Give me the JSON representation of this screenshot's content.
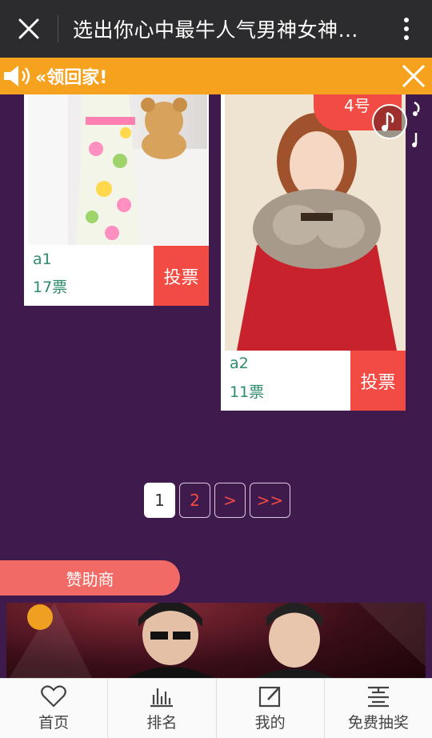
{
  "topbar": {
    "title": "选出你心中最牛人气男神女神…"
  },
  "banner": {
    "text": "«领回家!"
  },
  "contestants": [
    {
      "name": "a1",
      "votes": "17票",
      "vote_label": "投票"
    },
    {
      "name": "a2",
      "votes": "11票",
      "vote_label": "投票",
      "number_badge": "4号"
    }
  ],
  "pagination": {
    "pages": [
      "1",
      "2",
      ">",
      ">>"
    ],
    "current": "1"
  },
  "sponsor": {
    "label": "赞助商"
  },
  "bottom_nav": [
    {
      "label": "首页",
      "icon": "heart-icon"
    },
    {
      "label": "排名",
      "icon": "bar-chart-icon"
    },
    {
      "label": "我的",
      "icon": "edit-icon"
    },
    {
      "label": "免费抽奖",
      "icon": "lottery-icon"
    }
  ],
  "colors": {
    "background": "#3f1a4d",
    "accent": "#f24b44",
    "banner": "#f7a21f",
    "text_green": "#2e8b6e"
  }
}
